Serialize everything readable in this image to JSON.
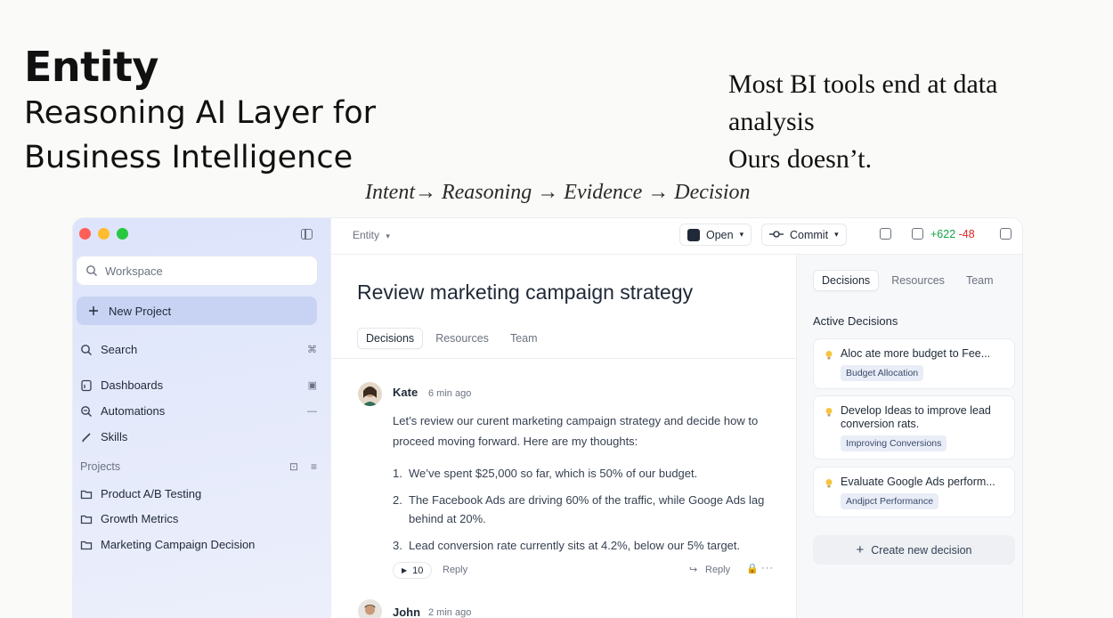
{
  "hero": {
    "title": "Entity",
    "subtitle": "Reasoning AI Layer for Business Intelligence",
    "tagline_line1": "Most BI tools end at data analysis",
    "tagline_line2": "Ours doesn’t.",
    "flow": "Intent→ Reasoning → Evidence → Decision"
  },
  "colors": {
    "accent": "#c8d3f3",
    "additions": "#16a34a",
    "deletions": "#dc2626",
    "red": "#ff5f57",
    "yellow": "#febc2e",
    "green": "#28c840"
  },
  "sidebar": {
    "search_placeholder": "Workspace",
    "new_project": "New Project",
    "nav": [
      {
        "label": "Search",
        "icon": "search-icon"
      },
      {
        "label": "Dashboards",
        "icon": "dashboard-icon"
      },
      {
        "label": "Automations",
        "icon": "automation-icon"
      },
      {
        "label": "Skills",
        "icon": "pen-icon"
      }
    ],
    "projects_label": "Projects",
    "projects": [
      {
        "label": "Product A/B Testing",
        "icon": "folder-icon"
      },
      {
        "label": "Growth Metrics",
        "icon": "folder-icon"
      },
      {
        "label": "Marketing Campaign Decision",
        "icon": "folder-icon"
      }
    ]
  },
  "topbar": {
    "breadcrumb": "Entity",
    "open_label": "Open",
    "commit_label": "Commit",
    "additions": "+622",
    "deletions": "-48"
  },
  "main": {
    "title": "Review marketing campaign strategy",
    "tabs": [
      "Decisions",
      "Resources",
      "Team"
    ],
    "messages": [
      {
        "author": "Kate",
        "time": "6 min ago",
        "text": "Let’s review our curent marketing campaign strategy and decide how to proceed moving forward. Here are my thoughts:",
        "points": [
          {
            "num": "1.",
            "text": "We’ve spent $25,000 so far, which is 50% of our budget."
          },
          {
            "num": "2.",
            "text": "The Facebook Ads are driving 60% of the traffic, while Googe Ads lag behind at 20%."
          },
          {
            "num": "3.",
            "text": "Lead conversion rate currently sits at 4.2%, below our 5% target."
          }
        ],
        "reply_count": "10",
        "reply_label": "Reply",
        "reply_action": "Reply",
        "more": "···"
      },
      {
        "author": "John",
        "time": "2 min ago"
      }
    ]
  },
  "panel": {
    "tabs": [
      "Decisions",
      "Resources",
      "Team"
    ],
    "heading": "Active Decisions",
    "decisions": [
      {
        "title": "Aloc ate more budget to Fee...",
        "tag": "Budget Allocation"
      },
      {
        "title": "Develop Ideas to improve lead conversion rats.",
        "tag": "Improving Conversions"
      },
      {
        "title": "Evaluate Google Ads perform...",
        "tag": "Andjpct Performance"
      }
    ],
    "create_label": "Create new decision"
  }
}
